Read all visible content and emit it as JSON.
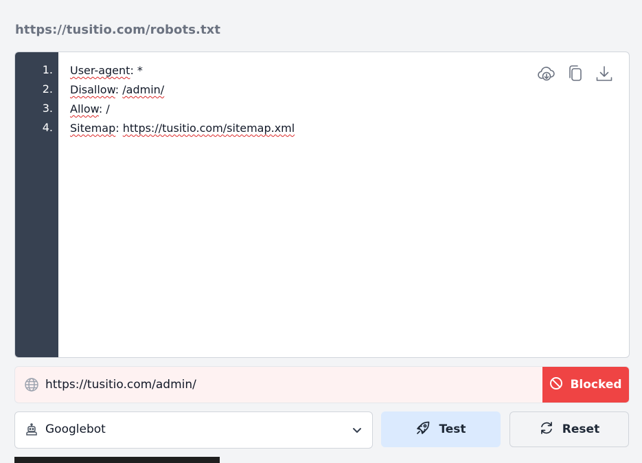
{
  "header": {
    "url": "https://tusitio.com/robots.txt"
  },
  "editor": {
    "line_numbers": [
      "1.",
      "2.",
      "3.",
      "4."
    ],
    "lines": [
      {
        "key": "User-agent",
        "sep": ": ",
        "value": "*"
      },
      {
        "key": "Disallow",
        "sep": ": ",
        "value": "/admin/"
      },
      {
        "key": "Allow",
        "sep": ": ",
        "value": "/"
      },
      {
        "key": "Sitemap",
        "sep": ": ",
        "value": "https://tusitio.com/sitemap.xml"
      }
    ],
    "toolbar_icons": [
      "cloud-download-icon",
      "copy-icon",
      "download-icon"
    ]
  },
  "tester": {
    "url_value": "https://tusitio.com/admin/",
    "status_label": "Blocked",
    "status_color": "#ef4444",
    "row_background": "#fef2f2"
  },
  "controls": {
    "user_agent_selected": "Googlebot",
    "test_label": "Test",
    "reset_label": "Reset",
    "test_color": "#dbeafe"
  }
}
